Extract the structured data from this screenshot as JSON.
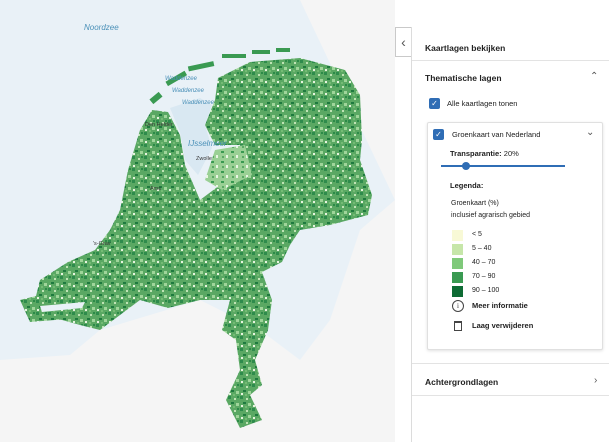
{
  "map": {
    "sea_labels": [
      "Noordzee",
      "Waddenzee",
      "Waddenzee",
      "Waddenzee",
      "IJsselmeer"
    ],
    "city_labels": [
      "Den Helder",
      "Zwolle",
      "'s-Grav",
      "Ams"
    ],
    "colors": {
      "sea": "#e9f1f7",
      "land_light": "#a9d8a4",
      "land_dark": "#2e8b4c",
      "neighbour": "#f4f4f4"
    }
  },
  "panel": {
    "title": "Kaartlagen bekijken",
    "thematic": {
      "title": "Thematische lagen",
      "show_all_label": "Alle kaartlagen tonen",
      "show_all_checked": true
    },
    "layer": {
      "name": "Groenkaart van Nederland",
      "checked": true,
      "transparency_label": "Transparantie:",
      "transparency_value": "20%",
      "transparency_fraction": 0.2,
      "legend_title": "Legenda:",
      "legend_header": "Groenkaart (%)",
      "legend_sub": "inclusief agrarisch gebied",
      "legend": [
        {
          "label": "< 5",
          "color": "#f8f9d6"
        },
        {
          "label": "5 – 40",
          "color": "#c6e6a9"
        },
        {
          "label": "40 – 70",
          "color": "#7fc97a"
        },
        {
          "label": "70 – 90",
          "color": "#3a9a52"
        },
        {
          "label": "90 – 100",
          "color": "#0e6b34"
        }
      ],
      "more_info": "Meer informatie",
      "remove": "Laag verwijderen"
    },
    "background": {
      "title": "Achtergrondlagen"
    },
    "icons": {
      "collapse": "chevron-left-icon",
      "expand": "chevron-up-icon",
      "layer_expand": "chevron-down-icon",
      "background_expand": "chevron-right-icon",
      "info": "info-icon",
      "trash": "trash-icon"
    }
  }
}
